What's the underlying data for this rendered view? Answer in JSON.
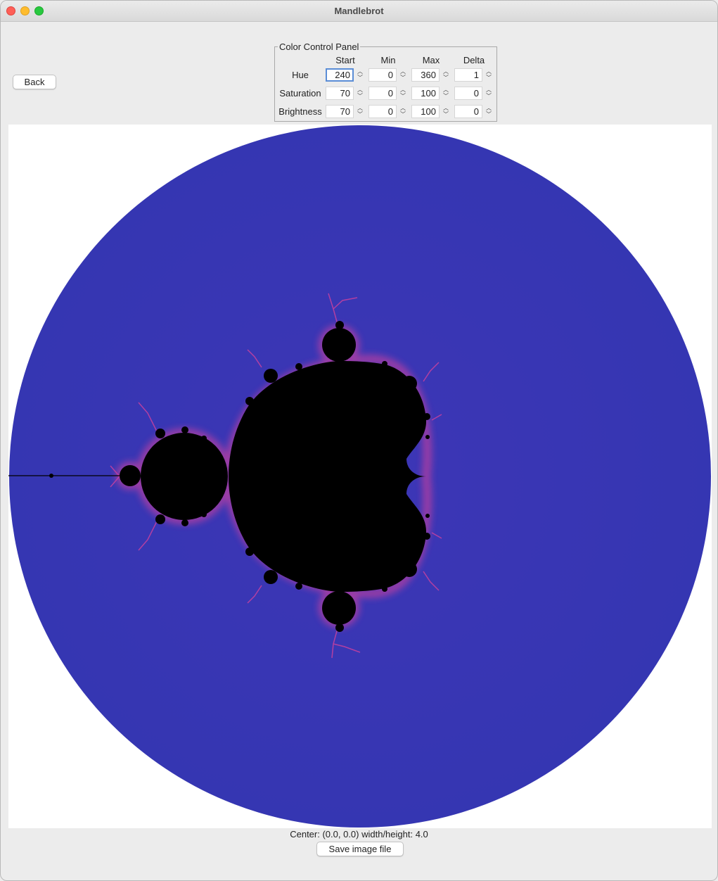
{
  "window": {
    "title": "Mandlebrot"
  },
  "toolbar": {
    "back_label": "Back"
  },
  "color_panel": {
    "title": "Color Control Panel",
    "columns": [
      "Start",
      "Min",
      "Max",
      "Delta"
    ],
    "rows": [
      {
        "label": "Hue",
        "values": [
          "240",
          "0",
          "360",
          "1"
        ]
      },
      {
        "label": "Saturation",
        "values": [
          "70",
          "0",
          "100",
          "0"
        ]
      },
      {
        "label": "Brightness",
        "values": [
          "70",
          "0",
          "100",
          "0"
        ]
      }
    ]
  },
  "status": {
    "text": "Center: (0.0, 0.0) width/height: 4.0"
  },
  "actions": {
    "save_label": "Save image file"
  },
  "colors": {
    "fractal_fill": "#3737b3",
    "set_fill": "#000000",
    "edge_glow": "#c040a0"
  },
  "icons": {
    "spinner_up": "chevron-up-icon",
    "spinner_down": "chevron-down-icon"
  }
}
